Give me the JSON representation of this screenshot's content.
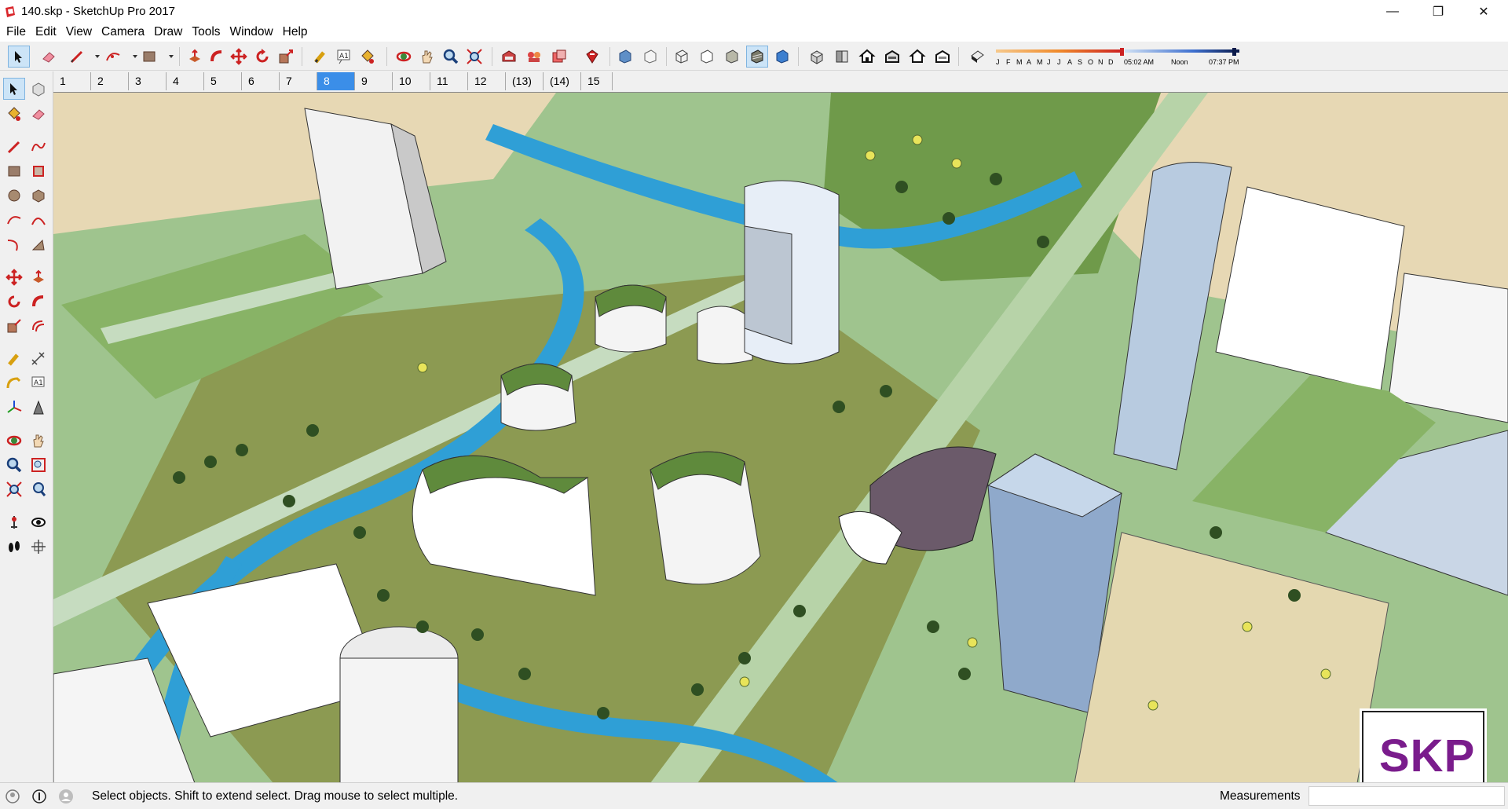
{
  "window": {
    "title": "140.skp - SketchUp Pro 2017",
    "controls": {
      "minimize": "—",
      "restore": "❐",
      "close": "✕"
    }
  },
  "menu": [
    "File",
    "Edit",
    "View",
    "Camera",
    "Draw",
    "Tools",
    "Window",
    "Help"
  ],
  "toolbar": {
    "shadow_months": [
      "J",
      "F",
      "M",
      "A",
      "M",
      "J",
      "J",
      "A",
      "S",
      "O",
      "N",
      "D"
    ],
    "time_start": "05:02 AM",
    "time_mid": "Noon",
    "time_end": "07:37 PM"
  },
  "scenes": {
    "tabs": [
      "1",
      "2",
      "3",
      "4",
      "5",
      "6",
      "7",
      "8",
      "9",
      "10",
      "11",
      "12",
      "(13)",
      "(14)",
      "15"
    ],
    "active_index": 7
  },
  "status": {
    "hint": "Select objects. Shift to extend select. Drag mouse to select multiple.",
    "measurements_label": "Measurements",
    "measurements_value": ""
  },
  "watermark": {
    "text": "SKP"
  },
  "colors": {
    "accent": "#3b8ee8",
    "logo": "#7a1c8c"
  }
}
